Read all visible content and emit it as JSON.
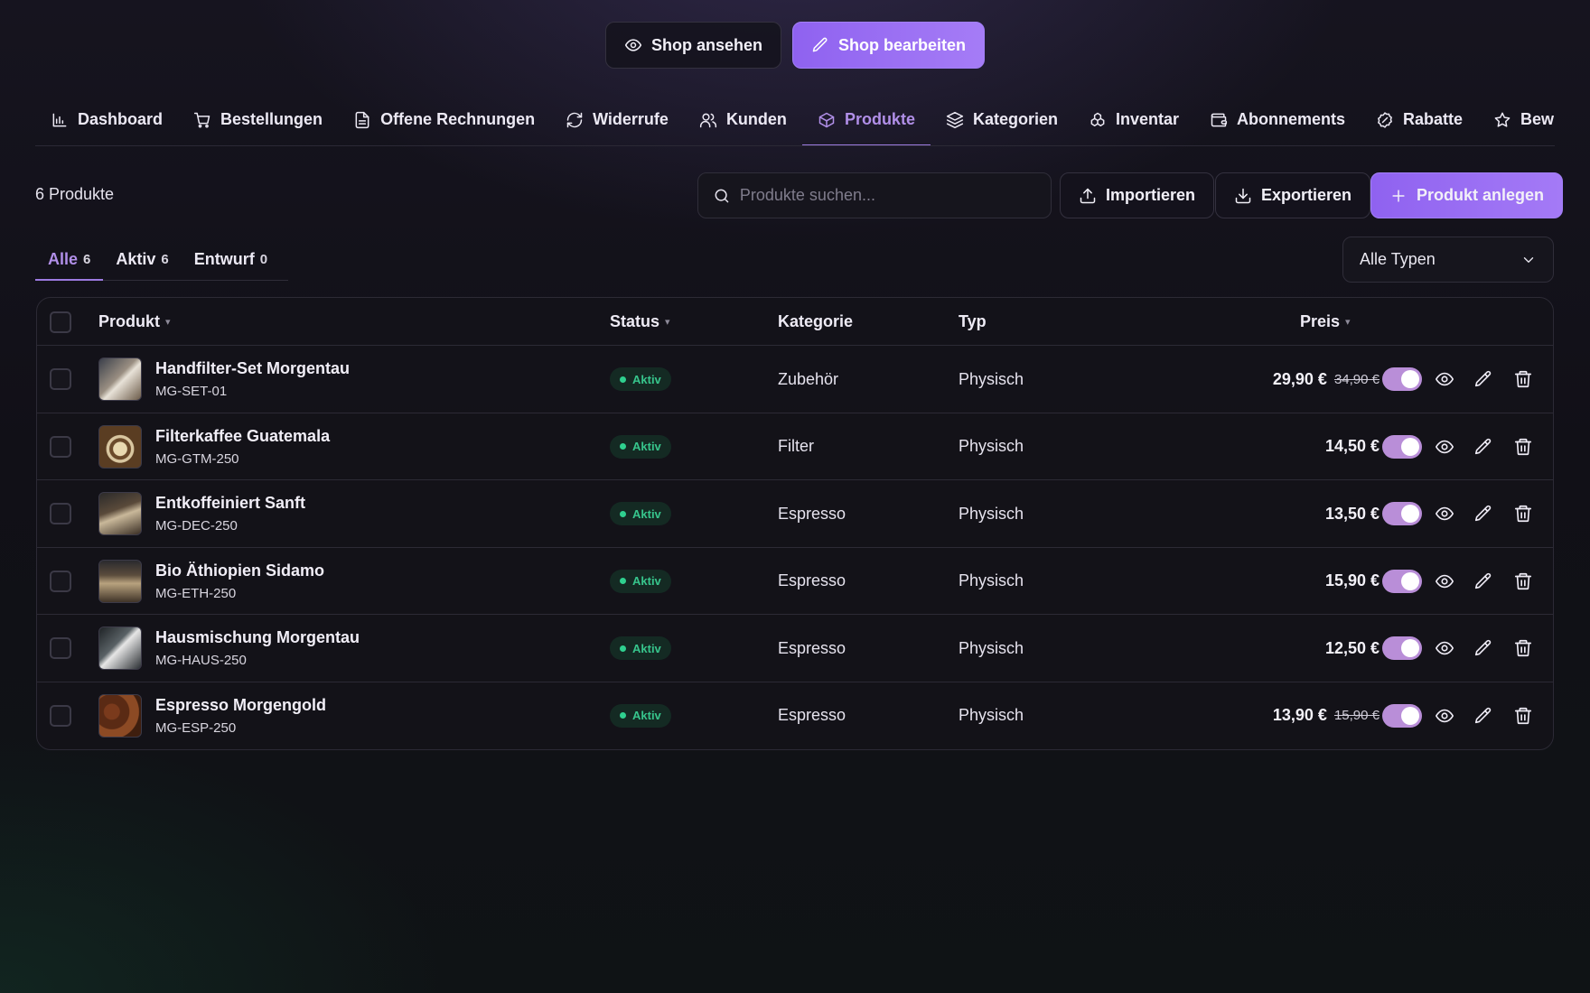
{
  "header": {
    "view_shop": "Shop ansehen",
    "edit_shop": "Shop bearbeiten"
  },
  "nav": {
    "items": [
      {
        "label": "Dashboard",
        "icon": "chart-icon"
      },
      {
        "label": "Bestellungen",
        "icon": "cart-icon"
      },
      {
        "label": "Offene Rechnungen",
        "icon": "document-icon"
      },
      {
        "label": "Widerrufe",
        "icon": "refresh-icon"
      },
      {
        "label": "Kunden",
        "icon": "users-icon"
      },
      {
        "label": "Produkte",
        "icon": "box-icon",
        "active": true
      },
      {
        "label": "Kategorien",
        "icon": "layers-icon"
      },
      {
        "label": "Inventar",
        "icon": "inventory-icon"
      },
      {
        "label": "Abonnements",
        "icon": "wallet-icon"
      },
      {
        "label": "Rabatte",
        "icon": "badge-percent-icon"
      },
      {
        "label": "Bew",
        "icon": "star-icon"
      }
    ]
  },
  "toolbar": {
    "count": "6 Produkte",
    "search_placeholder": "Produkte suchen...",
    "import": "Importieren",
    "export": "Exportieren",
    "create": "Produkt anlegen",
    "type_filter": "Alle Typen"
  },
  "filter_tabs": [
    {
      "label": "Alle",
      "count": "6",
      "active": true
    },
    {
      "label": "Aktiv",
      "count": "6"
    },
    {
      "label": "Entwurf",
      "count": "0"
    }
  ],
  "table": {
    "headers": {
      "product": "Produkt",
      "status": "Status",
      "category": "Kategorie",
      "type": "Typ",
      "price": "Preis"
    },
    "rows": [
      {
        "name": "Handfilter-Set Morgentau",
        "sku": "MG-SET-01",
        "status": "Aktiv",
        "category": "Zubehör",
        "type": "Physisch",
        "price": "29,90 €",
        "old_price": "34,90 €",
        "enabled": true
      },
      {
        "name": "Filterkaffee Guatemala",
        "sku": "MG-GTM-250",
        "status": "Aktiv",
        "category": "Filter",
        "type": "Physisch",
        "price": "14,50 €",
        "old_price": "",
        "enabled": true
      },
      {
        "name": "Entkoffeiniert Sanft",
        "sku": "MG-DEC-250",
        "status": "Aktiv",
        "category": "Espresso",
        "type": "Physisch",
        "price": "13,50 €",
        "old_price": "",
        "enabled": true
      },
      {
        "name": "Bio Äthiopien Sidamo",
        "sku": "MG-ETH-250",
        "status": "Aktiv",
        "category": "Espresso",
        "type": "Physisch",
        "price": "15,90 €",
        "old_price": "",
        "enabled": true
      },
      {
        "name": "Hausmischung Morgentau",
        "sku": "MG-HAUS-250",
        "status": "Aktiv",
        "category": "Espresso",
        "type": "Physisch",
        "price": "12,50 €",
        "old_price": "",
        "enabled": true
      },
      {
        "name": "Espresso Morgengold",
        "sku": "MG-ESP-250",
        "status": "Aktiv",
        "category": "Espresso",
        "type": "Physisch",
        "price": "13,90 €",
        "old_price": "15,90 €",
        "enabled": true
      }
    ]
  },
  "colors": {
    "accent": "#9c6ef2",
    "active_tab": "#b18fe8",
    "status_green": "#2fd08f",
    "toggle_on": "#b98ed8"
  }
}
